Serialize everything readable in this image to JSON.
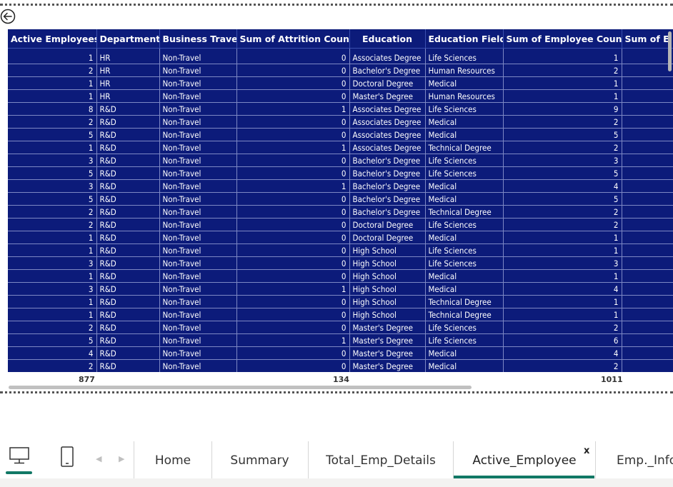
{
  "table": {
    "headers": [
      "Active Employees",
      "Department",
      "Business Travel",
      "Sum of Attrition Count",
      "Education",
      "Education Field",
      "Sum of Employee Count",
      "Sum of E"
    ],
    "rows": [
      [
        "1",
        "HR",
        "Non-Travel",
        "0",
        "Associates Degree",
        "Life Sciences",
        "1"
      ],
      [
        "2",
        "HR",
        "Non-Travel",
        "0",
        "Bachelor's Degree",
        "Human Resources",
        "2"
      ],
      [
        "1",
        "HR",
        "Non-Travel",
        "0",
        "Doctoral Degree",
        "Medical",
        "1"
      ],
      [
        "1",
        "HR",
        "Non-Travel",
        "0",
        "Master's Degree",
        "Human Resources",
        "1"
      ],
      [
        "8",
        "R&D",
        "Non-Travel",
        "1",
        "Associates Degree",
        "Life Sciences",
        "9"
      ],
      [
        "2",
        "R&D",
        "Non-Travel",
        "0",
        "Associates Degree",
        "Medical",
        "2"
      ],
      [
        "5",
        "R&D",
        "Non-Travel",
        "0",
        "Associates Degree",
        "Medical",
        "5"
      ],
      [
        "1",
        "R&D",
        "Non-Travel",
        "1",
        "Associates Degree",
        "Technical Degree",
        "2"
      ],
      [
        "3",
        "R&D",
        "Non-Travel",
        "0",
        "Bachelor's Degree",
        "Life Sciences",
        "3"
      ],
      [
        "5",
        "R&D",
        "Non-Travel",
        "0",
        "Bachelor's Degree",
        "Life Sciences",
        "5"
      ],
      [
        "3",
        "R&D",
        "Non-Travel",
        "1",
        "Bachelor's Degree",
        "Medical",
        "4"
      ],
      [
        "5",
        "R&D",
        "Non-Travel",
        "0",
        "Bachelor's Degree",
        "Medical",
        "5"
      ],
      [
        "2",
        "R&D",
        "Non-Travel",
        "0",
        "Bachelor's Degree",
        "Technical Degree",
        "2"
      ],
      [
        "2",
        "R&D",
        "Non-Travel",
        "0",
        "Doctoral Degree",
        "Life Sciences",
        "2"
      ],
      [
        "1",
        "R&D",
        "Non-Travel",
        "0",
        "Doctoral Degree",
        "Medical",
        "1"
      ],
      [
        "1",
        "R&D",
        "Non-Travel",
        "0",
        "High School",
        "Life Sciences",
        "1"
      ],
      [
        "3",
        "R&D",
        "Non-Travel",
        "0",
        "High School",
        "Life Sciences",
        "3"
      ],
      [
        "1",
        "R&D",
        "Non-Travel",
        "0",
        "High School",
        "Medical",
        "1"
      ],
      [
        "3",
        "R&D",
        "Non-Travel",
        "1",
        "High School",
        "Medical",
        "4"
      ],
      [
        "1",
        "R&D",
        "Non-Travel",
        "0",
        "High School",
        "Technical Degree",
        "1"
      ],
      [
        "1",
        "R&D",
        "Non-Travel",
        "0",
        "High School",
        "Technical Degree",
        "1"
      ],
      [
        "2",
        "R&D",
        "Non-Travel",
        "0",
        "Master's Degree",
        "Life Sciences",
        "2"
      ],
      [
        "5",
        "R&D",
        "Non-Travel",
        "1",
        "Master's Degree",
        "Life Sciences",
        "6"
      ],
      [
        "4",
        "R&D",
        "Non-Travel",
        "0",
        "Master's Degree",
        "Medical",
        "4"
      ],
      [
        "2",
        "R&D",
        "Non-Travel",
        "0",
        "Master's Degree",
        "Medical",
        "2"
      ]
    ],
    "totals": {
      "active_employees": "877",
      "attrition": "134",
      "employee_count": "1011"
    }
  },
  "tabs": [
    "Home",
    "Summary",
    "Total_Emp_Details",
    "Active_Employee",
    "Emp._Info"
  ],
  "active_tab": "Active_Employee",
  "close_label": "x",
  "icons": {
    "back": "back-arrow-icon",
    "desktop": "desktop-icon",
    "mobile": "mobile-icon",
    "prev": "chevron-left-icon",
    "next": "chevron-right-icon"
  },
  "colors": {
    "header_bg": "#0c1b7a",
    "accent": "#117865"
  }
}
